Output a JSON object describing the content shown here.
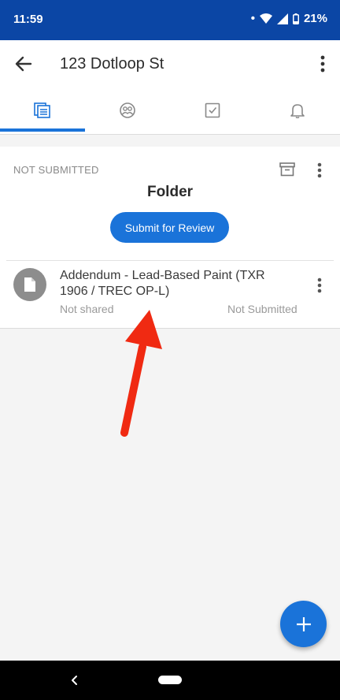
{
  "status_bar": {
    "time": "11:59",
    "battery": "21%",
    "dot": "•"
  },
  "app_bar": {
    "title": "123 Dotloop St"
  },
  "tabs": [
    {
      "name": "documents",
      "icon": "documents-icon",
      "selected": true
    },
    {
      "name": "people",
      "icon": "people-icon",
      "selected": false
    },
    {
      "name": "tasks",
      "icon": "tasks-icon",
      "selected": false
    },
    {
      "name": "notifications",
      "icon": "bell-icon",
      "selected": false
    }
  ],
  "folder": {
    "status": "NOT SUBMITTED",
    "title": "Folder",
    "submit_label": "Submit for Review"
  },
  "document": {
    "title": "Addendum - Lead-Based Paint (TXR 1906 / TREC OP-L)",
    "shared_status": "Not shared",
    "submission_status": "Not Submitted"
  },
  "colors": {
    "brand": "#0b46a5",
    "accent": "#1a73d9",
    "annotation": "#f02a12"
  }
}
